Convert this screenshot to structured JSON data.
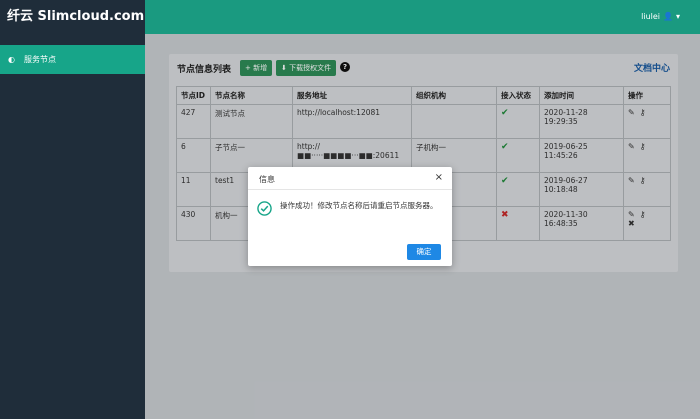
{
  "brand": "纤云 Slimcloud.com",
  "sidebar": {
    "items": [
      {
        "label": "服务节点",
        "icon": "dashboard-icon"
      }
    ]
  },
  "header": {
    "user": "liulei"
  },
  "panel": {
    "title": "节点信息列表",
    "add_button": "+ 新增",
    "download_button": "下载授权文件",
    "help": "?",
    "doc_link": "文档中心"
  },
  "table": {
    "headers": [
      "节点ID",
      "节点名称",
      "服务地址",
      "组织机构",
      "接入状态",
      "添加时间",
      "操作"
    ],
    "rows": [
      {
        "id": "427",
        "name": "测试节点",
        "address": "http://localhost:12081",
        "org": "",
        "status": "ok",
        "time1": "2020-11-28",
        "time2": "19:29:35"
      },
      {
        "id": "6",
        "name": "子节点一",
        "address": "http://■■·····■■■■···■■:20611",
        "org": "子机构一",
        "status": "ok",
        "time1": "2019-06-25",
        "time2": "11:45:26"
      },
      {
        "id": "11",
        "name": "test1",
        "address": "",
        "org": "",
        "status": "ok",
        "time1": "2019-06-27",
        "time2": "10:18:48"
      },
      {
        "id": "430",
        "name": "机构一",
        "address": "",
        "org": "",
        "status": "bad",
        "time1": "2020-11-30",
        "time2": "16:48:35"
      }
    ]
  },
  "modal": {
    "title": "信息",
    "close": "×",
    "message": "操作成功！修改节点名称后请重启节点服务器。",
    "ok_button": "确定"
  }
}
